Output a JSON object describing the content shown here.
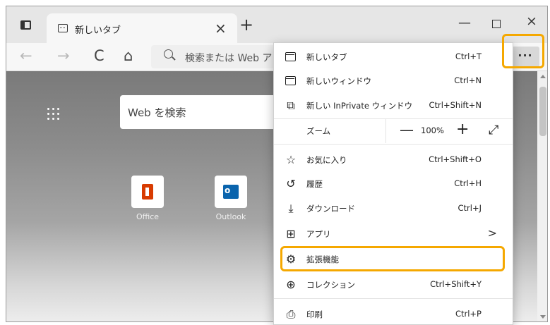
{
  "tab": {
    "title": "新しいタブ",
    "close": "×"
  },
  "titlebar": {
    "new_tab": "+",
    "minimize": "—",
    "close": "×"
  },
  "toolbar": {
    "back": "←",
    "forward": "→",
    "reload": "C",
    "home": "⌂",
    "address_placeholder": "検索または Web アドレスを入力",
    "more": "···"
  },
  "page": {
    "search_placeholder": "Web を検索",
    "quick_links": [
      {
        "label": "Office"
      },
      {
        "label": "Outlook"
      }
    ]
  },
  "menu": {
    "items": [
      {
        "label": "新しいタブ",
        "shortcut": "Ctrl+T"
      },
      {
        "label": "新しいウィンドウ",
        "shortcut": "Ctrl+N"
      },
      {
        "label": "新しい InPrivate ウィンドウ",
        "shortcut": "Ctrl+Shift+N"
      },
      {
        "label": "お気に入り",
        "shortcut": "Ctrl+Shift+O"
      },
      {
        "label": "履歴",
        "shortcut": "Ctrl+H"
      },
      {
        "label": "ダウンロード",
        "shortcut": "Ctrl+J"
      },
      {
        "label": "アプリ",
        "shortcut": ""
      },
      {
        "label": "拡張機能",
        "shortcut": ""
      },
      {
        "label": "コレクション",
        "shortcut": "Ctrl+Shift+Y"
      },
      {
        "label": "印刷",
        "shortcut": "Ctrl+P"
      }
    ],
    "zoom": {
      "label": "ズーム",
      "minus": "—",
      "value": "100%",
      "plus": "+",
      "fullscreen": "⤢"
    },
    "apps_arrow": ">"
  },
  "colors": {
    "highlight": "#f5a800",
    "office": "#d83b01",
    "outlook": "#0a64ad"
  }
}
